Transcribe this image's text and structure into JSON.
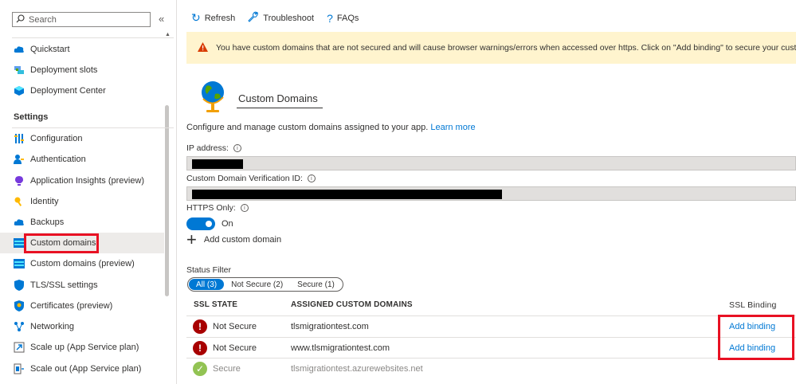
{
  "sidebar": {
    "search_placeholder": "Search",
    "items_top": [
      {
        "label": "Quickstart",
        "icon": "cloud-bolt-icon"
      },
      {
        "label": "Deployment slots",
        "icon": "slots-icon"
      },
      {
        "label": "Deployment Center",
        "icon": "cube-icon"
      }
    ],
    "settings_title": "Settings",
    "items_settings": [
      {
        "label": "Configuration",
        "icon": "sliders-icon"
      },
      {
        "label": "Authentication",
        "icon": "person-key-icon"
      },
      {
        "label": "Application Insights (preview)",
        "icon": "lightbulb-icon"
      },
      {
        "label": "Identity",
        "icon": "key-icon"
      },
      {
        "label": "Backups",
        "icon": "cloud-icon"
      },
      {
        "label": "Custom domains",
        "icon": "domains-icon"
      },
      {
        "label": "Custom domains (preview)",
        "icon": "domains-icon"
      },
      {
        "label": "TLS/SSL settings",
        "icon": "shield-icon"
      },
      {
        "label": "Certificates (preview)",
        "icon": "certificate-icon"
      },
      {
        "label": "Networking",
        "icon": "network-icon"
      },
      {
        "label": "Scale up (App Service plan)",
        "icon": "scale-up-icon"
      },
      {
        "label": "Scale out (App Service plan)",
        "icon": "scale-out-icon"
      }
    ]
  },
  "toolbar": {
    "refresh": "Refresh",
    "troubleshoot": "Troubleshoot",
    "faqs": "FAQs"
  },
  "banner": {
    "text": "You have custom domains that are not secured and will cause browser warnings/errors when accessed over https. Click on \"Add binding\" to secure your custom domains"
  },
  "main": {
    "title": "Custom Domains",
    "description": "Configure and manage custom domains assigned to your app.",
    "learn_more": "Learn more",
    "ip_label": "IP address:",
    "verification_label": "Custom Domain Verification ID:",
    "https_label": "HTTPS Only:",
    "https_state": "On",
    "add_custom_domain": "Add custom domain",
    "status_filter_label": "Status Filter",
    "filters": [
      "All (3)",
      "Not Secure (2)",
      "Secure (1)"
    ]
  },
  "table": {
    "headers": {
      "ssl_state": "SSL STATE",
      "assigned": "ASSIGNED CUSTOM DOMAINS",
      "ssl_binding": "SSL Binding"
    },
    "rows": [
      {
        "state": "Not Secure",
        "domain": "tlsmigrationtest.com",
        "binding": "Add binding"
      },
      {
        "state": "Not Secure",
        "domain": "www.tlsmigrationtest.com",
        "binding": "Add binding"
      },
      {
        "state": "Secure",
        "domain": "tlsmigrationtest.azurewebsites.net",
        "binding": ""
      }
    ]
  }
}
